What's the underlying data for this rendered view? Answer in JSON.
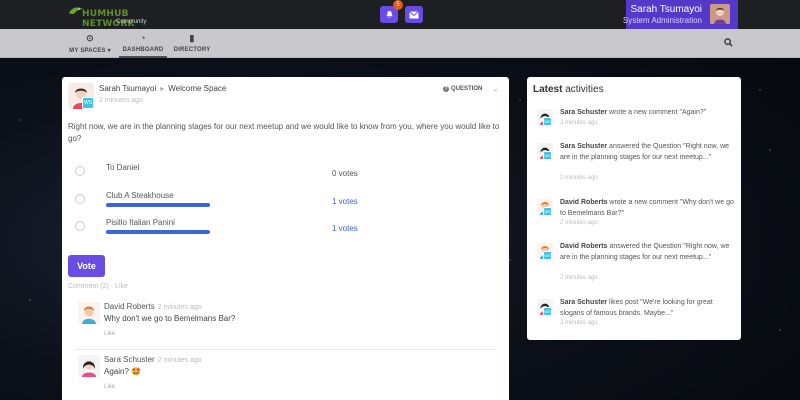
{
  "topbar": {
    "logo_text": "HUMHUB NETWORK",
    "logo_sub": "Community",
    "notification_count": "5",
    "user_name": "Sarah Tsumayoi",
    "user_role": "System Administration"
  },
  "nav": {
    "items": [
      {
        "label": "MY SPACES ▾",
        "icon": "grid-icon"
      },
      {
        "label": "DASHBOARD",
        "icon": "dashboard-icon"
      },
      {
        "label": "DIRECTORY",
        "icon": "book-icon"
      }
    ]
  },
  "post": {
    "author": "Sarah Tsumayoi",
    "space": "Welcome Space",
    "time": "2 minutes ago",
    "type": "QUESTION",
    "text": "Right now, we are in the planning stages for our next meetup and we would like to know from you, where you would like to go?",
    "options": [
      {
        "label": "To Daniel",
        "votes": "0 votes",
        "fraction": 0
      },
      {
        "label": "Club A Steakhouse",
        "votes": "1 votes",
        "fraction": 1
      },
      {
        "label": "Pisillo Italian Panini",
        "votes": "1 votes",
        "fraction": 1
      }
    ],
    "vote_label": "Vote",
    "comment_meta": "Comment (2) · Like",
    "comments": [
      {
        "author": "David Roberts",
        "time": "2 minutes ago",
        "text": "Why don't we go to Bemelmans Bar?",
        "like": "Like"
      },
      {
        "author": "Sara Schuster",
        "time": "2 minutes ago",
        "text": "Again? 🤩",
        "like": "Like"
      }
    ]
  },
  "activity": {
    "title_bold": "Latest",
    "title_rest": "activities",
    "items": [
      {
        "author": "Sara Schuster",
        "text": "wrote a new comment \"Again?\"",
        "time": "2 minutes ago"
      },
      {
        "author": "Sara Schuster",
        "text": "answered the Question \"Right now, we are in the planning stages for our next meetup...\"",
        "time": "2 minutes ago"
      },
      {
        "author": "David Roberts",
        "text": "wrote a new comment \"Why don't we go to Bemelmans Bar?\"",
        "time": "2 minutes ago"
      },
      {
        "author": "David Roberts",
        "text": "answered the Question \"Right now, we are in the planning stages for our next meetup...\"",
        "time": "2 minutes ago"
      },
      {
        "author": "Sara Schuster",
        "text": "likes post \"We're looking for great slogans of famous brands. Maybe...\"",
        "time": "2 minutes ago"
      }
    ]
  },
  "colors": {
    "accent": "#6a4ce4",
    "poll_bar": "#3a64d8",
    "link": "#3a64d8"
  }
}
